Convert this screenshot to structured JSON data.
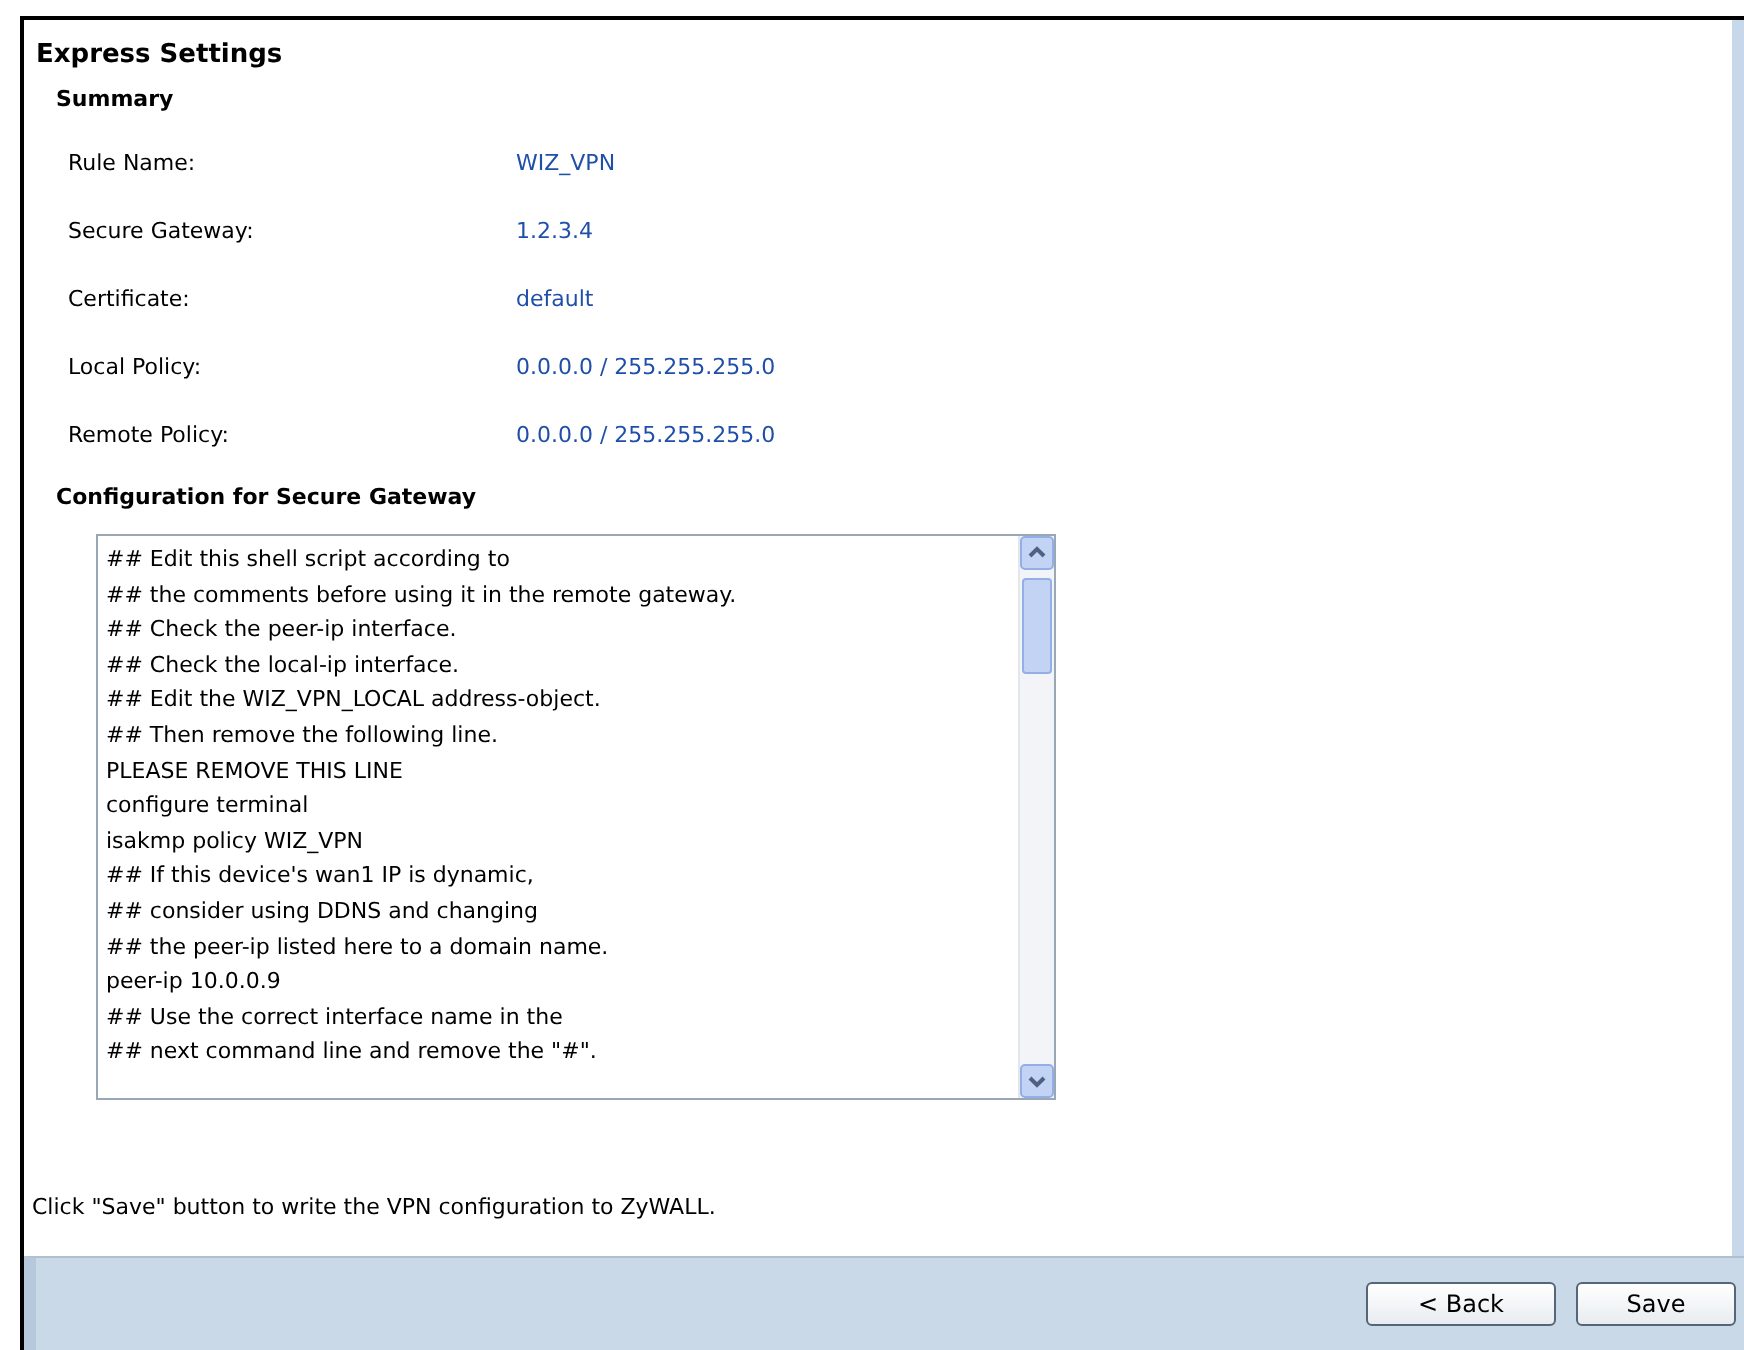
{
  "panel": {
    "title": "Express Settings"
  },
  "summary": {
    "heading": "Summary",
    "rows": [
      {
        "label": "Rule Name:",
        "value": "WIZ_VPN"
      },
      {
        "label": "Secure Gateway:",
        "value": "1.2.3.4"
      },
      {
        "label": "Certificate:",
        "value": "default"
      },
      {
        "label": "Local Policy:",
        "value": "0.0.0.0 / 255.255.255.0"
      },
      {
        "label": "Remote Policy:",
        "value": "0.0.0.0 / 255.255.255.0"
      }
    ]
  },
  "configuration": {
    "heading": "Configuration for Secure Gateway",
    "lines": [
      "## Edit this shell script according to",
      "## the comments before using it in the remote gateway.",
      "## Check the peer-ip interface.",
      "## Check the local-ip interface.",
      "## Edit the WIZ_VPN_LOCAL address-object.",
      "## Then remove the following line.",
      "PLEASE REMOVE THIS LINE",
      "configure terminal",
      "isakmp policy WIZ_VPN",
      "## If this device's wan1 IP is dynamic,",
      "## consider using DDNS and changing",
      "## the peer-ip listed here to a domain name.",
      "peer-ip 10.0.0.9",
      "## Use the correct interface name in the",
      "## next command line and remove the \"#\"."
    ]
  },
  "instruction": "Click \"Save\" button to write the VPN configuration to ZyWALL.",
  "buttons": [
    "< Back",
    "Save"
  ]
}
